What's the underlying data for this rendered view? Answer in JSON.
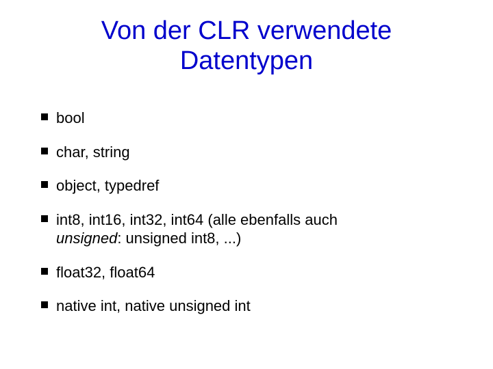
{
  "title_line1": "Von der CLR verwendete",
  "title_line2": "Datentypen",
  "bullets": {
    "b0": "bool",
    "b1": "char, string",
    "b2": "object, typedref",
    "b3_main": "int8, int16, int32, int64 (alle ebenfalls auch",
    "b3_unsigned_word": "unsigned",
    "b3_tail": ": unsigned int8, ...)",
    "b4": "float32, float64",
    "b5": "native int, native unsigned int"
  }
}
